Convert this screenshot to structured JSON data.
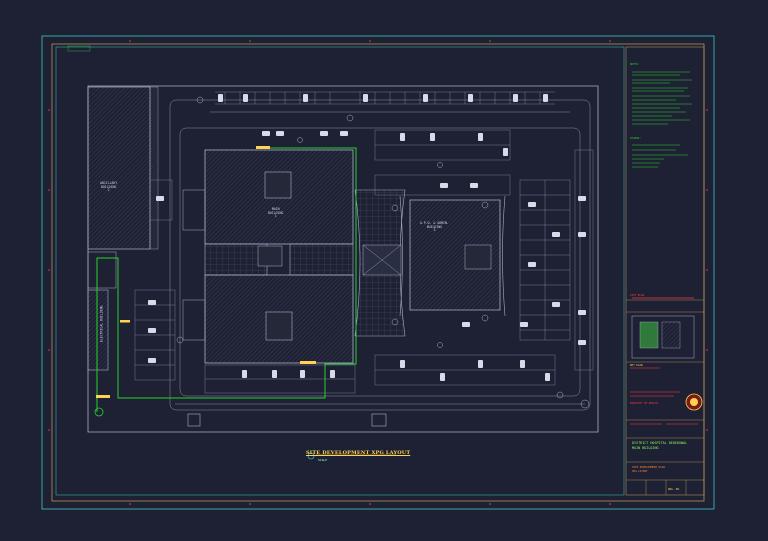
{
  "drawing": {
    "title": "SITE DEVELOPMENT XPG LAYOUT",
    "scale_note": "SCALE",
    "buildings": [
      {
        "key": "ancillary",
        "label_line1": "ANCILLARY",
        "label_line2": "BUILDING",
        "label_line3": "2"
      },
      {
        "key": "main",
        "label_line1": "MAIN",
        "label_line2": "BUILDING",
        "label_line3": "1"
      },
      {
        "key": "opd",
        "label_line1": "O.P.D. & ADMIN.",
        "label_line2": "BUILDING",
        "label_line3": "3"
      },
      {
        "key": "electrical",
        "label_line1": "ELECTRICAL",
        "label_line2": "BUILDING",
        "label_line3": ""
      }
    ]
  },
  "title_block": {
    "notes_heading": "NOTES:",
    "legend_heading": "LEGEND:",
    "key_plan_label": "KEY PLAN",
    "project_name_line1": "DISTRICT HOSPITAL DEDEDUWAL",
    "project_name_line2": "MAIN BUILDING",
    "drawing_title_line1": "SITE DEVELOPMENT PLAN",
    "drawing_title_line2": "XPG LAYOUT",
    "drawing_no": "DWG. NO.",
    "client_line": "MINISTRY OF HEALTH",
    "sheet_label": "SITE PLAN"
  },
  "colors": {
    "background": "#1e2134",
    "frame": "#c9a25a",
    "inner_frame": "#3fc9c4",
    "linework": "#aab0c8",
    "hatch": "#3a3e52",
    "route": "#2bd12b",
    "notes": "#2bd12b",
    "title": "#ffd34d",
    "red_accent": "#ff3a3a"
  }
}
